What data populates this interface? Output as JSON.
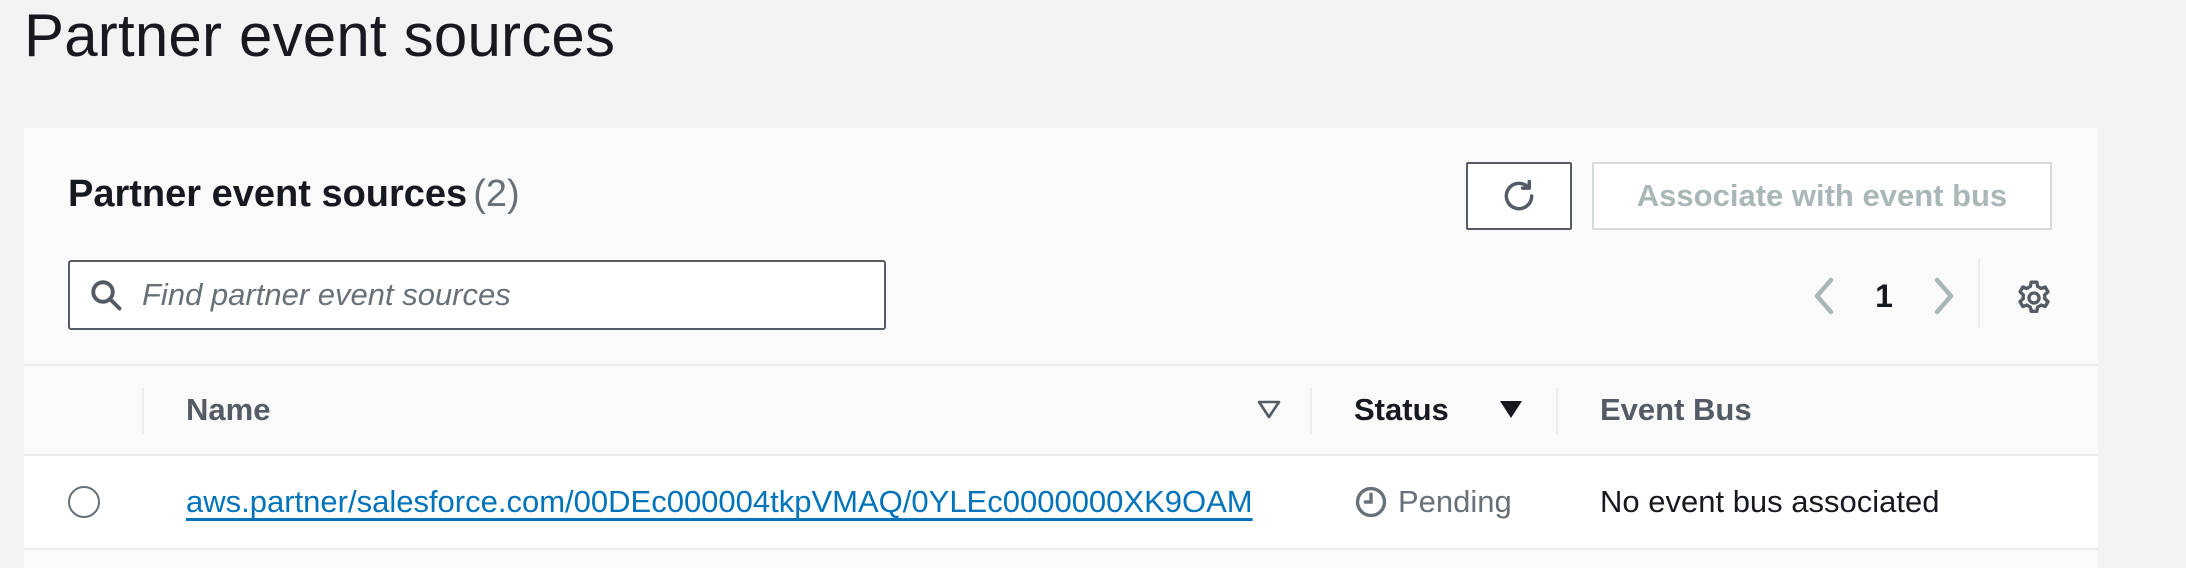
{
  "page": {
    "title": "Partner event sources"
  },
  "panel": {
    "title": "Partner event sources",
    "count": "(2)",
    "refresh_icon": "refresh-icon",
    "associate_label": "Associate with event bus",
    "search": {
      "placeholder": "Find partner event sources",
      "value": "",
      "icon": "search-icon"
    },
    "pagination": {
      "current_page": "1",
      "prev_icon": "chevron-left-icon",
      "next_icon": "chevron-right-icon"
    },
    "settings_icon": "gear-icon"
  },
  "table": {
    "columns": [
      {
        "label": "Name",
        "sort": "unsorted"
      },
      {
        "label": "Status",
        "sort": "descending"
      },
      {
        "label": "Event Bus"
      }
    ],
    "rows": [
      {
        "name": "aws.partner/salesforce.com/00DEc000004tkpVMAQ/0YLEc0000000XK9OAM",
        "status": "Pending",
        "status_icon": "clock-icon",
        "event_bus": "No event bus associated"
      }
    ]
  },
  "colors": {
    "link": "#0073bb",
    "disabled_text": "#aab7b8",
    "muted_text": "#687078",
    "page_background": "#f2f3f3"
  }
}
